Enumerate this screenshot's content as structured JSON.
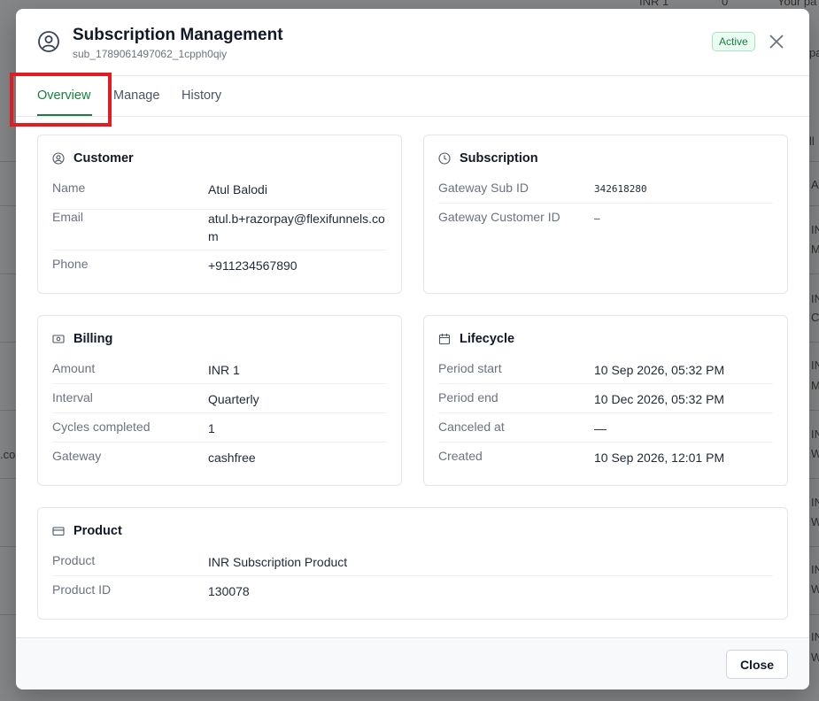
{
  "modal": {
    "title": "Subscription Management",
    "subtitle": "sub_1789061497062_1cpph0qiy",
    "status": "Active",
    "close_label": "Close"
  },
  "tabs": [
    {
      "label": "Overview",
      "active": true
    },
    {
      "label": "Manage",
      "active": false
    },
    {
      "label": "History",
      "active": false
    }
  ],
  "customer": {
    "title": "Customer",
    "rows": [
      {
        "label": "Name",
        "value": "Atul Balodi"
      },
      {
        "label": "Email",
        "value": "atul.b+razorpay@flexifunnels.com"
      },
      {
        "label": "Phone",
        "value": "+911234567890"
      }
    ]
  },
  "subscription": {
    "title": "Subscription",
    "rows": [
      {
        "label": "Gateway Sub ID",
        "value": "342618280"
      },
      {
        "label": "Gateway Customer ID",
        "value": "–"
      }
    ]
  },
  "billing": {
    "title": "Billing",
    "rows": [
      {
        "label": "Amount",
        "value": "INR 1"
      },
      {
        "label": "Interval",
        "value": "Quarterly"
      },
      {
        "label": "Cycles completed",
        "value": "1"
      },
      {
        "label": "Gateway",
        "value": "cashfree"
      }
    ]
  },
  "lifecycle": {
    "title": "Lifecycle",
    "rows": [
      {
        "label": "Period start",
        "value": "10 Sep 2026, 05:32 PM"
      },
      {
        "label": "Period end",
        "value": "10 Dec 2026, 05:32 PM"
      },
      {
        "label": "Canceled at",
        "value": "—"
      },
      {
        "label": "Created",
        "value": "10 Sep 2026, 12:01 PM"
      }
    ]
  },
  "product": {
    "title": "Product",
    "rows": [
      {
        "label": "Product",
        "value": "INR Subscription Product"
      },
      {
        "label": "Product ID",
        "value": "130078"
      }
    ]
  },
  "background": {
    "fragments": [
      "INR 1",
      "0",
      "Your pa",
      "pa",
      "ll",
      "A",
      "IN",
      "M",
      "IN",
      "C",
      "IN",
      "M",
      "IN",
      "W",
      "IN",
      "W",
      "IN",
      "W",
      "IN",
      "W",
      ".co"
    ]
  },
  "colors": {
    "accent": "#15803d",
    "highlight": "#e11d24"
  }
}
